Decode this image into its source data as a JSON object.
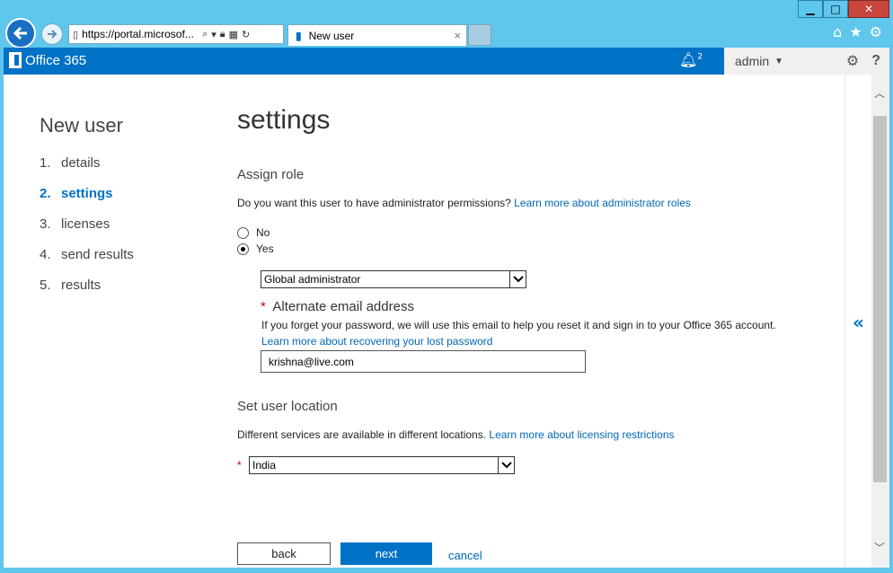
{
  "browser": {
    "address": "https://portal.microsof...",
    "tab_title": "New user",
    "tab_close": "×"
  },
  "window": {
    "minimize": "▁",
    "maximize": "□",
    "close": "✕"
  },
  "header": {
    "brand": "Office 365",
    "notification_count": "2",
    "user": "admin",
    "help": "?"
  },
  "wizard": {
    "title": "New user",
    "steps": [
      {
        "num": "1.",
        "label": "details"
      },
      {
        "num": "2.",
        "label": "settings"
      },
      {
        "num": "3.",
        "label": "licenses"
      },
      {
        "num": "4.",
        "label": "send results"
      },
      {
        "num": "5.",
        "label": "results"
      }
    ]
  },
  "main": {
    "title": "settings",
    "assign_role": {
      "heading": "Assign role",
      "question": "Do you want this user to have administrator permissions?",
      "learn_more": "Learn more about administrator roles",
      "option_no": "No",
      "option_yes": "Yes",
      "selected_role": "Global administrator"
    },
    "alt_email": {
      "required_mark": "*",
      "heading": "Alternate email address",
      "description": "If you forget your password, we will use this email to help you reset it and sign in to your Office 365 account.",
      "learn_more": "Learn more about recovering your lost password",
      "value": "krishna@live.com"
    },
    "location": {
      "heading": "Set user location",
      "description": "Different services are available in different locations.",
      "learn_more": "Learn more about licensing restrictions",
      "required_mark": "*",
      "selected": "India"
    },
    "buttons": {
      "back": "back",
      "next": "next",
      "cancel": "cancel"
    }
  },
  "colors": {
    "accent": "#0072c6",
    "link": "#0067b8",
    "chrome": "#5fc6ec"
  }
}
